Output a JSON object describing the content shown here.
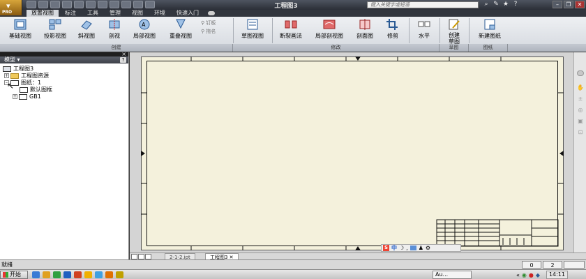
{
  "app": {
    "title": "工程图3",
    "logo_text": "PRO",
    "search_placeholder": "键入关键字或短语",
    "window_controls": [
      "–",
      "❐",
      "✕"
    ]
  },
  "ribbon_tabs": [
    {
      "label": "放置视图",
      "active": true
    },
    {
      "label": "标注",
      "active": false
    },
    {
      "label": "工具",
      "active": false
    },
    {
      "label": "管理",
      "active": false
    },
    {
      "label": "视图",
      "active": false
    },
    {
      "label": "环境",
      "active": false
    },
    {
      "label": "快速入门",
      "active": false
    }
  ],
  "ribbon": {
    "buttons": [
      {
        "label": "基础视图",
        "icon": "base-view-icon"
      },
      {
        "label": "投影视图",
        "icon": "projected-view-icon"
      },
      {
        "label": "斜视图",
        "icon": "auxiliary-view-icon"
      },
      {
        "label": "剖视",
        "icon": "section-view-icon"
      },
      {
        "label": "局部视图",
        "icon": "detail-view-icon"
      },
      {
        "label": "重叠视图",
        "icon": "overlay-view-icon"
      },
      {
        "label": "草图视图",
        "icon": "draft-view-icon"
      },
      {
        "label": "断裂画法",
        "icon": "break-icon"
      },
      {
        "label": "局部剖视图",
        "icon": "breakout-icon"
      },
      {
        "label": "剖面图",
        "icon": "slice-icon"
      },
      {
        "label": "修剪",
        "icon": "crop-icon"
      },
      {
        "label": "水平",
        "icon": "horizontal-icon"
      },
      {
        "label": "创建草图",
        "icon": "create-sketch-icon"
      },
      {
        "label": "新建图纸",
        "icon": "new-sheet-icon"
      }
    ],
    "small_buttons": [
      "钉板",
      "拖名"
    ],
    "panels": [
      "创建",
      "修改",
      "草图",
      "图纸"
    ]
  },
  "browser": {
    "header": "模型 ▾",
    "help": "?",
    "tree": [
      {
        "label": "工程图3",
        "level": 0,
        "icon": "drawing",
        "expander": ""
      },
      {
        "label": "工程图资源",
        "level": 1,
        "icon": "folder",
        "expander": "+"
      },
      {
        "label": "图纸：1",
        "level": 1,
        "icon": "sheet",
        "expander": "–"
      },
      {
        "label": "默认图框",
        "level": 2,
        "icon": "sheet",
        "expander": ""
      },
      {
        "label": "GB1",
        "level": 2,
        "icon": "sheet",
        "expander": "+"
      }
    ]
  },
  "doc_tabs": [
    {
      "label": "2-1-2.ipt",
      "active": false
    },
    {
      "label": "工程图3 ✕",
      "active": true
    }
  ],
  "ime": {
    "s": "S",
    "zh": "中"
  },
  "status": {
    "text": "就绪",
    "count1": "0",
    "count2": "2"
  },
  "taskbar": {
    "start": "开始",
    "item": "Au...",
    "clock": "14:11"
  },
  "colors": {
    "sheet_bg": "#f4f1dc",
    "ribbon_bg": "#e3e6ea",
    "title_bg": "#2b2f37"
  }
}
